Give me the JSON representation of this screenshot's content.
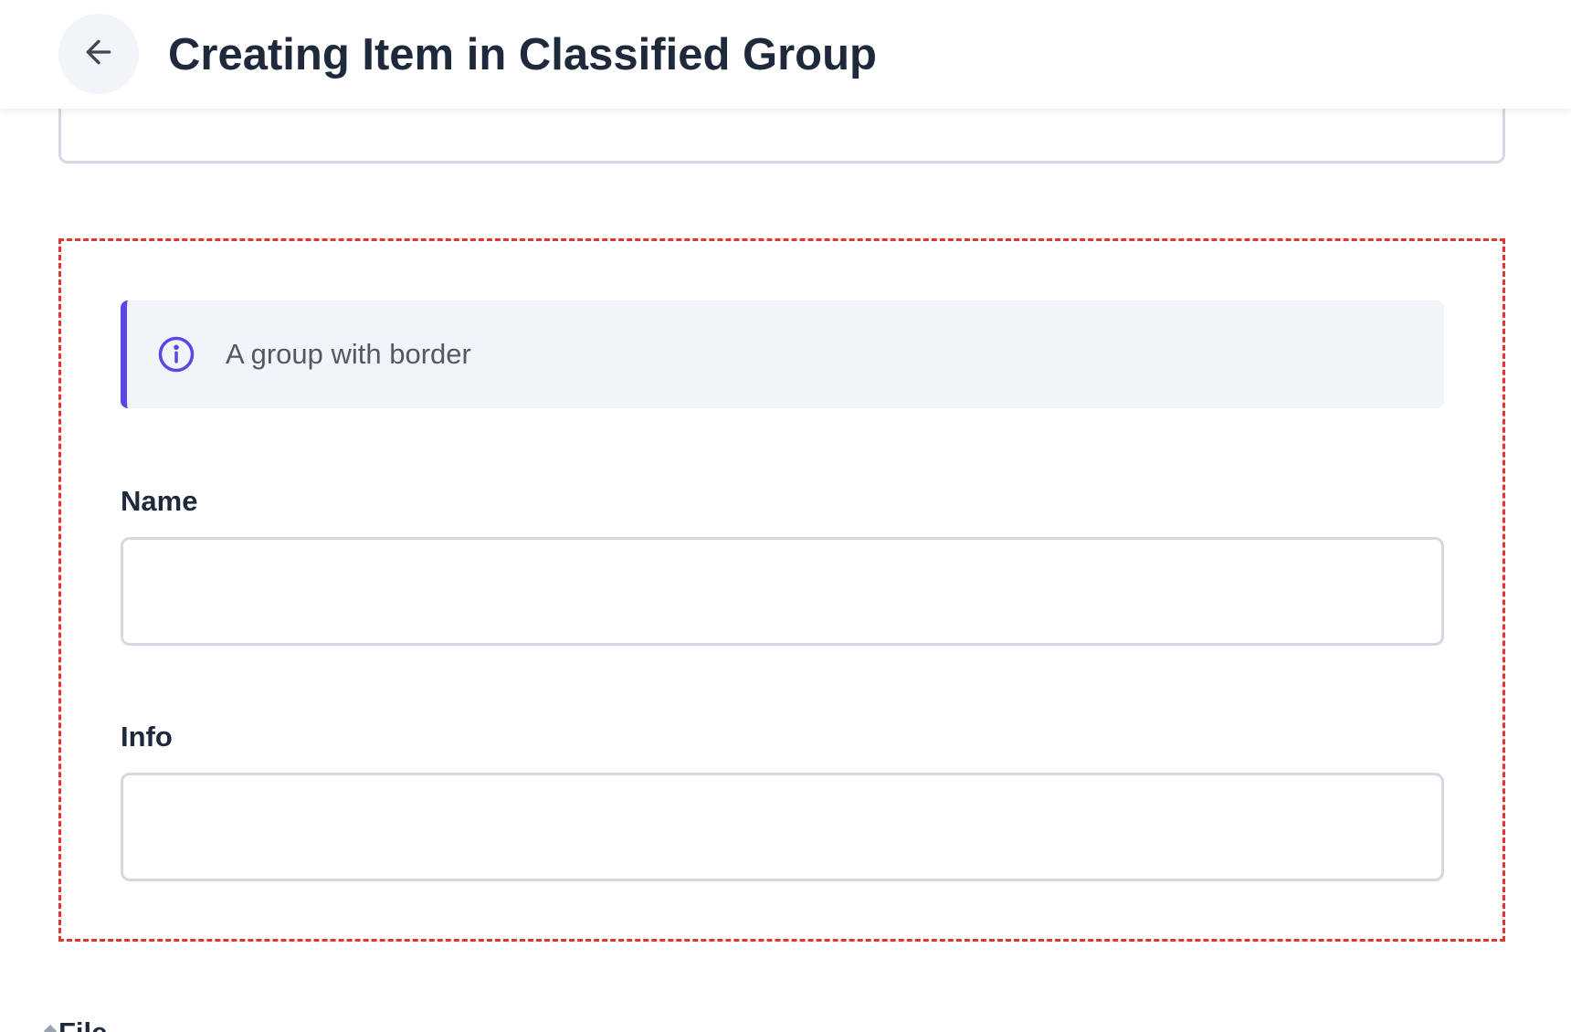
{
  "header": {
    "title": "Creating Item in Classified Group",
    "back_icon": "arrow-left-icon"
  },
  "group": {
    "border_style": "dashed",
    "border_color": "#e3342f",
    "callout": {
      "icon": "info-circle-icon",
      "icon_color": "#5a46e6",
      "text": "A group with border"
    },
    "fields": {
      "name": {
        "label": "Name",
        "value": ""
      },
      "info": {
        "label": "Info",
        "value": ""
      }
    }
  },
  "next_field": {
    "label": "File"
  }
}
